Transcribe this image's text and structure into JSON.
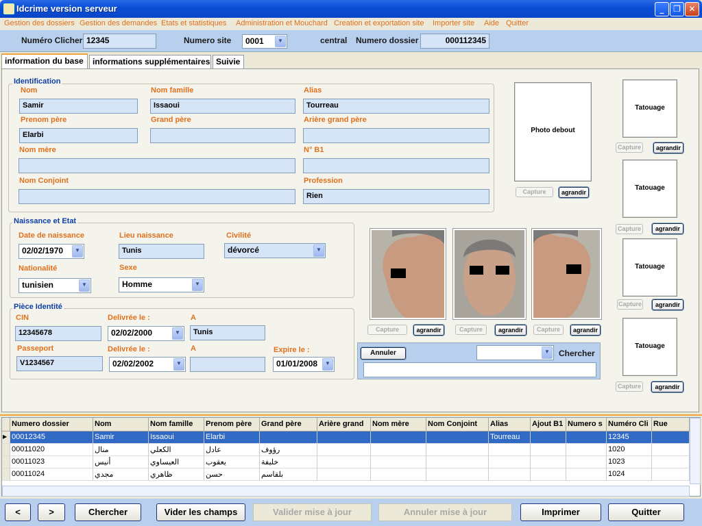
{
  "window": {
    "title": "Idcrime version serveur",
    "minimize": "_",
    "maximize": "❐",
    "close": "✕"
  },
  "menu": [
    "Gestion des dossiers",
    "Gestion des demandes",
    "Etats et statistiques",
    "Administration et Mouchard",
    "Creation et exportation site",
    "Importer site",
    "Aide",
    "Quitter"
  ],
  "infobar": {
    "numero_clicher_label": "Numéro Clicher",
    "numero_clicher": "12345",
    "numero_site_label": "Numero site",
    "numero_site": "0001",
    "central_label": "central",
    "numero_dossier_label": "Numero dossier",
    "numero_dossier": "000112345"
  },
  "tabs": [
    "information du base",
    "informations supplémentaires",
    "Suivie"
  ],
  "identification": {
    "title": "Identification",
    "nom_label": "Nom",
    "nom": "Samir",
    "nom_famille_label": "Nom famille",
    "nom_famille": "Issaoui",
    "alias_label": "Alias",
    "alias": "Tourreau",
    "prenom_pere_label": "Prenom père",
    "prenom_pere": "Elarbi",
    "grand_pere_label": "Grand père",
    "grand_pere": "",
    "ariere_label": "Arière grand père",
    "ariere": "",
    "nom_mere_label": "Nom mère",
    "nom_mere": "",
    "nb1_label": "N° B1",
    "nb1": "",
    "conjoint_label": "Nom  Conjoint",
    "conjoint": "",
    "profession_label": "Profession",
    "profession": "Rien"
  },
  "naissance": {
    "title": "Naissance et Etat",
    "date_label": "Date de naissance",
    "date": "02/02/1970",
    "lieu_label": "Lieu naissance",
    "lieu": "Tunis",
    "civilite_label": "Civilité",
    "civilite": "dévorcé",
    "nationalite_label": "Nationalité",
    "nationalite": "tunisien",
    "sexe_label": "Sexe",
    "sexe": "Homme"
  },
  "piece": {
    "title": "Pièce Identité",
    "cin_label": "CIN",
    "cin": "12345678",
    "delivree_label": "Delivrée le :",
    "cin_date": "02/02/2000",
    "a_label": "A",
    "cin_lieu": "Tunis",
    "passeport_label": "Passeport",
    "passeport": "V1234567",
    "pass_date": "02/02/2002",
    "pass_lieu": "",
    "expire_label": "Expire le :",
    "expire": "01/01/2008"
  },
  "photos": {
    "debout": "Photo debout",
    "tatouage": "Tatouage",
    "capture": "Capture",
    "agrandir": "agrandir"
  },
  "search": {
    "annuler": "Annuler",
    "chercher": "Chercher",
    "select": "",
    "text": ""
  },
  "grid": {
    "headers": [
      "Numero dossier",
      "Nom",
      "Nom famille",
      "Prenom père",
      "Grand père",
      "Arière grand",
      "Nom mère",
      "Nom  Conjoint",
      "Alias",
      "Ajout B1",
      "Numero s",
      "Numéro Cli",
      "Rue"
    ],
    "rows": [
      [
        "00012345",
        "Samir",
        "Issaoui",
        "Elarbi",
        "",
        "",
        "",
        "",
        "Tourreau",
        "",
        "",
        "12345",
        ""
      ],
      [
        "00011020",
        "منال",
        "الكعلي",
        "عادل",
        "رؤوف",
        "",
        "",
        "",
        "",
        "",
        "",
        "1020",
        ""
      ],
      [
        "00011023",
        "أنيس",
        "العيساوي",
        "يعقوب",
        "خليفة",
        "",
        "",
        "",
        "",
        "",
        "",
        "1023",
        ""
      ],
      [
        "00011024",
        "مجدي",
        "ظاهري",
        "حسن",
        "بلقاسم",
        "",
        "",
        "",
        "",
        "",
        "",
        "1024",
        ""
      ]
    ]
  },
  "bottom": {
    "prev": "<",
    "next": ">",
    "chercher": "Chercher",
    "vider": "Vider les champs",
    "valider": "Valider mise à jour",
    "annuler": "Annuler mise à jour",
    "imprimer": "Imprimer",
    "quitter": "Quitter"
  },
  "colors": {
    "accent": "#e0701c",
    "group_title": "#0e3ea8",
    "selected_row": "#316ac5",
    "titlebar": "#0a4fd6"
  }
}
